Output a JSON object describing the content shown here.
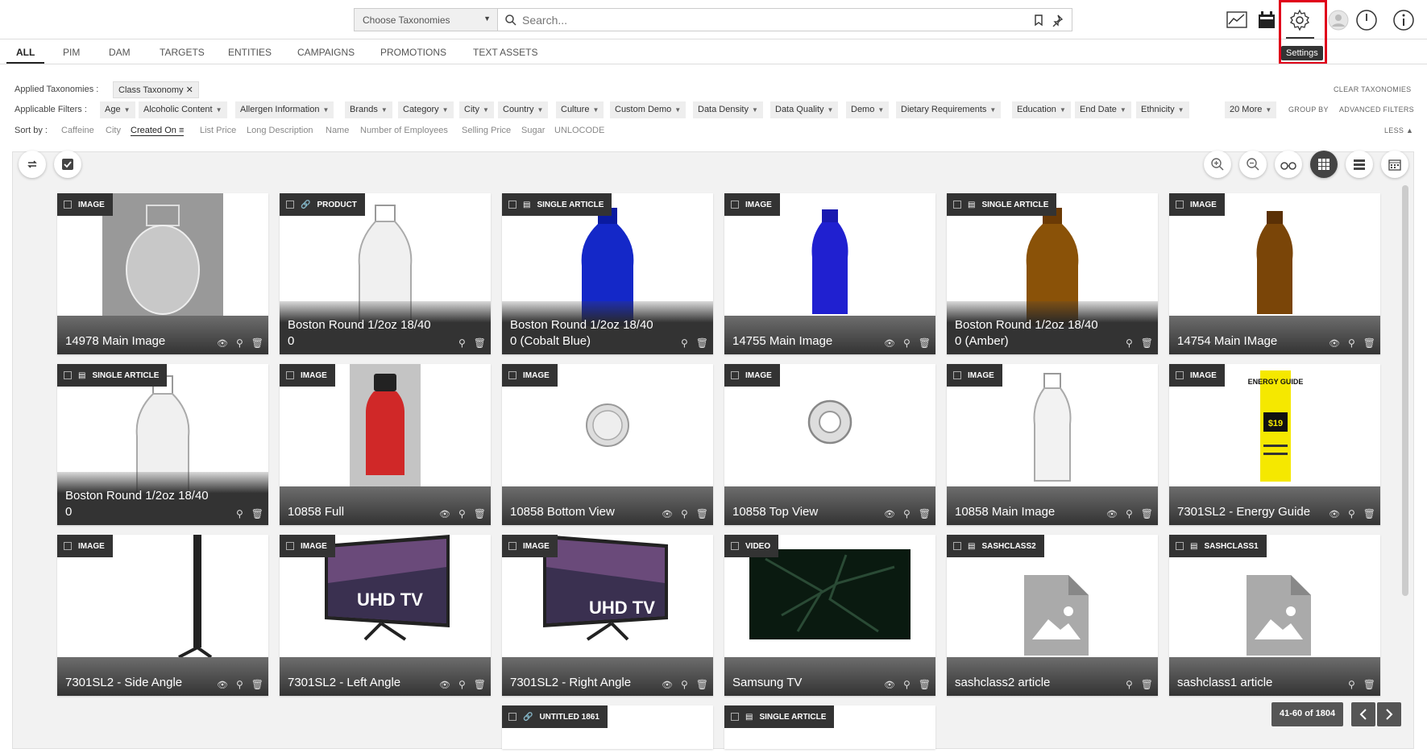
{
  "header": {
    "taxonomy_select": "Choose Taxonomies",
    "search_placeholder": "Search...",
    "settings_tooltip": "Settings"
  },
  "tabs": [
    "ALL",
    "PIM",
    "DAM",
    "TARGETS",
    "ENTITIES",
    "CAMPAIGNS",
    "PROMOTIONS",
    "TEXT ASSETS"
  ],
  "filters": {
    "applied_label": "Applied Taxonomies :",
    "applied_chip": "Class Taxonomy",
    "applicable_label": "Applicable Filters :",
    "items": [
      "Age",
      "Alcoholic Content",
      "Allergen Information",
      "Brands",
      "Category",
      "City",
      "Country",
      "Culture",
      "Custom Demo",
      "Data Density",
      "Data Quality",
      "Demo",
      "Dietary Requirements",
      "Education",
      "End Date",
      "Ethnicity"
    ],
    "more": "20 More",
    "group_by": "GROUP BY",
    "advanced": "ADVANCED FILTERS",
    "clear": "CLEAR TAXONOMIES",
    "sort_label": "Sort by :",
    "sort_items": [
      "Caffeine",
      "City",
      "Created On",
      "List Price",
      "Long Description",
      "Name",
      "Number of Employees",
      "Selling Price",
      "Sugar",
      "UNLOCODE"
    ],
    "less": "LESS"
  },
  "cards": [
    {
      "type": "IMAGE",
      "title": "14978 Main Image"
    },
    {
      "type": "PRODUCT",
      "title": "Boston Round 1/2oz 18/40 0"
    },
    {
      "type": "SINGLE ARTICLE",
      "title": "Boston Round 1/2oz 18/40 0 (Cobalt Blue)"
    },
    {
      "type": "IMAGE",
      "title": "14755 Main Image"
    },
    {
      "type": "SINGLE ARTICLE",
      "title": "Boston Round 1/2oz 18/40 0 (Amber)"
    },
    {
      "type": "IMAGE",
      "title": "14754 Main IMage"
    },
    {
      "type": "SINGLE ARTICLE",
      "title": "Boston Round 1/2oz 18/40 0"
    },
    {
      "type": "IMAGE",
      "title": "10858 Full"
    },
    {
      "type": "IMAGE",
      "title": "10858 Bottom View"
    },
    {
      "type": "IMAGE",
      "title": "10858 Top View"
    },
    {
      "type": "IMAGE",
      "title": "10858 Main Image"
    },
    {
      "type": "IMAGE",
      "title": "7301SL2 - Energy Guide"
    },
    {
      "type": "IMAGE",
      "title": "7301SL2 - Side Angle"
    },
    {
      "type": "IMAGE",
      "title": "7301SL2 - Left Angle"
    },
    {
      "type": "IMAGE",
      "title": "7301SL2 - Right Angle"
    },
    {
      "type": "VIDEO",
      "title": "Samsung TV"
    },
    {
      "type": "SASHCLASS2",
      "title": "sashclass2 article"
    },
    {
      "type": "SASHCLASS1",
      "title": "sashclass1 article"
    },
    {
      "type": "UNTITLED 1861",
      "title": ""
    },
    {
      "type": "SINGLE ARTICLE",
      "title": ""
    }
  ],
  "energy_guide": {
    "heading": "ENERGY GUIDE",
    "price": "$19"
  },
  "tv_logo": "UHD TV",
  "pager": {
    "label": "41-60 of 1804"
  },
  "icons": [
    "chart-icon",
    "calendar-icon",
    "settings-icon",
    "user-icon",
    "power-icon",
    "info-icon",
    "refresh-icon",
    "check-icon",
    "zoom-in-icon",
    "zoom-out-icon",
    "binoculars-icon",
    "grid-icon",
    "list-icon"
  ]
}
